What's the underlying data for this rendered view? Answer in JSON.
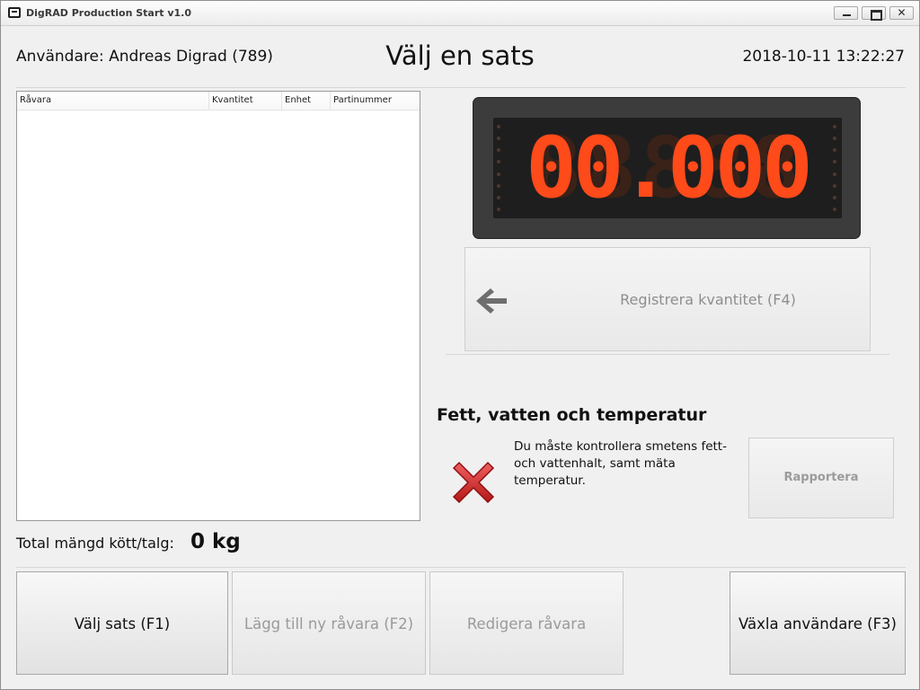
{
  "window": {
    "title": "DigRAD Production Start v1.0",
    "close_glyph": "✕"
  },
  "header": {
    "user": "Användare: Andreas Digrad (789)",
    "title": "Välj en sats",
    "datetime": "2018-10-11 13:22:27"
  },
  "table": {
    "columns": [
      "Råvara",
      "Kvantitet",
      "Enhet",
      "Partinummer"
    ],
    "rows": []
  },
  "total": {
    "label": "Total mängd kött/talg:",
    "value": "0 kg"
  },
  "scale_display": {
    "value": "00.000",
    "color": "#ff4a1a"
  },
  "register_button": {
    "label": "Registrera kvantitet (F4)",
    "icon": "arrow-left-icon"
  },
  "fat_check": {
    "title": "Fett, vatten och temperatur",
    "message": "Du måste kontrollera smetens fett- och vattenhalt, samt mäta temperatur.",
    "status_icon": "red-x-icon",
    "report_label": "Rapportera"
  },
  "footer": {
    "select_batch": "Välj sats (F1)",
    "add_material": "Lägg till ny råvara (F2)",
    "edit_material": "Redigera råvara",
    "switch_user": "Växla användare (F3)"
  }
}
